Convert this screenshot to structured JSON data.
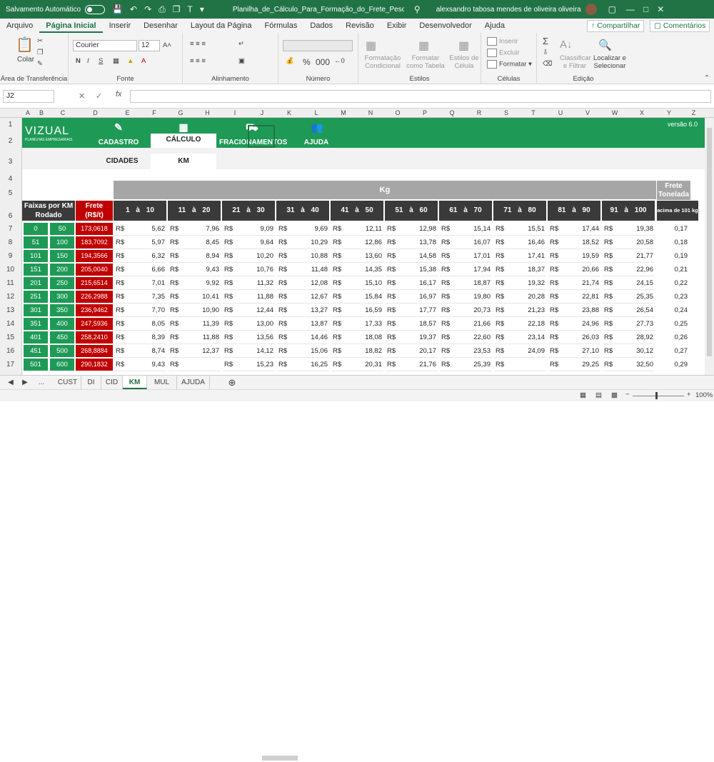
{
  "titlebar": {
    "autosave": "Salvamento Automático",
    "filename": "Planilha_de_Cálculo_Para_Formação_do_Frete_Peso_Fraci...",
    "user": "alexsandro tabosa mendes de oliveira oliveira"
  },
  "menu": [
    "Arquivo",
    "Página Inicial",
    "Inserir",
    "Desenhar",
    "Layout da Página",
    "Fórmulas",
    "Dados",
    "Revisão",
    "Exibir",
    "Desenvolvedor",
    "Ajuda"
  ],
  "share": "Compartilhar",
  "comments": "Comentários",
  "ribbon": {
    "clipboard": {
      "paste": "Colar",
      "label": "Área de Transferência"
    },
    "font": {
      "name": "Courier",
      "size": "12",
      "label": "Fonte",
      "bold": "N",
      "italic": "I",
      "underline": "S"
    },
    "alignment": {
      "label": "Alinhamento"
    },
    "number": {
      "label": "Número"
    },
    "styles": {
      "cond": "Formatação Condicional",
      "table": "Formatar como Tabela",
      "cell": "Estilos de Célula",
      "label": "Estilos"
    },
    "cells": {
      "insert": "Inserir",
      "delete": "Excluir",
      "format": "Formatar",
      "label": "Células"
    },
    "edit": {
      "sort": "Classificar e Filtrar",
      "find": "Localizar e Selecionar",
      "label": "Edição"
    }
  },
  "namebox": "J2",
  "columns": [
    "A",
    "B",
    "C",
    "D",
    "E",
    "F",
    "G",
    "H",
    "I",
    "J",
    "K",
    "L",
    "M",
    "N",
    "O",
    "P",
    "Q",
    "R",
    "S",
    "T",
    "U",
    "V",
    "W",
    "X",
    "Y",
    "Z"
  ],
  "rows": [
    "1",
    "2",
    "3",
    "4",
    "5",
    "6",
    "7",
    "8",
    "9",
    "10",
    "11",
    "12",
    "13",
    "14",
    "15",
    "16",
    "17"
  ],
  "app": {
    "logo": "VIZUAL",
    "logo_sub": "PLANILHAS EMPRESARIAIS",
    "version": "versão 6.0",
    "nav": [
      "CADASTRO",
      "CÁLCULO",
      "FRACIONAMENTOS",
      "AJUDA"
    ],
    "subnav": [
      "CIDADES",
      "KM"
    ]
  },
  "table": {
    "kg_label": "Kg",
    "frete_tonelada": "Frete Tonelada",
    "faixas_header": "Faixas por KM Rodado",
    "frete_header": "Frete (R$/t)",
    "acima_header": "acima de 101 kg",
    "ranges": [
      "1  à  10",
      "11  à  20",
      "21  à  30",
      "31  à  40",
      "41  à  50",
      "51  à  60",
      "61  à  70",
      "71  à  80",
      "81  à  90",
      "91  à  100"
    ],
    "currency": "R$",
    "rows": [
      {
        "from": "0",
        "to": "50",
        "frete": "173,0618",
        "vals": [
          "5,62",
          "7,96",
          "9,09",
          "9,69",
          "12,11",
          "12,98",
          "15,14",
          "15,51",
          "17,44",
          "19,38"
        ],
        "ton": "0,17"
      },
      {
        "from": "51",
        "to": "100",
        "frete": "183,7092",
        "vals": [
          "5,97",
          "8,45",
          "9,64",
          "10,29",
          "12,86",
          "13,78",
          "16,07",
          "16,46",
          "18,52",
          "20,58"
        ],
        "ton": "0,18"
      },
      {
        "from": "101",
        "to": "150",
        "frete": "194,3566",
        "vals": [
          "6,32",
          "8,94",
          "10,20",
          "10,88",
          "13,60",
          "14,58",
          "17,01",
          "17,41",
          "19,59",
          "21,77"
        ],
        "ton": "0,19"
      },
      {
        "from": "151",
        "to": "200",
        "frete": "205,0040",
        "vals": [
          "6,66",
          "9,43",
          "10,76",
          "11,48",
          "14,35",
          "15,38",
          "17,94",
          "18,37",
          "20,66",
          "22,96"
        ],
        "ton": "0,21"
      },
      {
        "from": "201",
        "to": "250",
        "frete": "215,6514",
        "vals": [
          "7,01",
          "9,92",
          "11,32",
          "12,08",
          "15,10",
          "16,17",
          "18,87",
          "19,32",
          "21,74",
          "24,15"
        ],
        "ton": "0,22"
      },
      {
        "from": "251",
        "to": "300",
        "frete": "226,2988",
        "vals": [
          "7,35",
          "10,41",
          "11,88",
          "12,67",
          "15,84",
          "16,97",
          "19,80",
          "20,28",
          "22,81",
          "25,35"
        ],
        "ton": "0,23"
      },
      {
        "from": "301",
        "to": "350",
        "frete": "236,9462",
        "vals": [
          "7,70",
          "10,90",
          "12,44",
          "13,27",
          "16,59",
          "17,77",
          "20,73",
          "21,23",
          "23,88",
          "26,54"
        ],
        "ton": "0,24"
      },
      {
        "from": "351",
        "to": "400",
        "frete": "247,5936",
        "vals": [
          "8,05",
          "11,39",
          "13,00",
          "13,87",
          "17,33",
          "18,57",
          "21,66",
          "22,18",
          "24,96",
          "27,73"
        ],
        "ton": "0,25"
      },
      {
        "from": "401",
        "to": "450",
        "frete": "258,2410",
        "vals": [
          "8,39",
          "11,88",
          "13,56",
          "14,46",
          "18,08",
          "19,37",
          "22,60",
          "23,14",
          "26,03",
          "28,92"
        ],
        "ton": "0,26"
      },
      {
        "from": "451",
        "to": "500",
        "frete": "268,8884",
        "vals": [
          "8,74",
          "12,37",
          "14,12",
          "15,06",
          "18,82",
          "20,17",
          "23,53",
          "24,09",
          "27,10",
          "30,12"
        ],
        "ton": "0,27"
      },
      {
        "from": "501",
        "to": "600",
        "frete": "290,1832",
        "vals": [
          "9,43",
          "",
          "15,23",
          "16,25",
          "20,31",
          "21,76",
          "25,39",
          "",
          "29,25",
          "32,50"
        ],
        "ton": "0,29"
      }
    ]
  },
  "sheettabs": [
    "CUST",
    "DI",
    "CID",
    "KM",
    "MUL",
    "AJUDA"
  ],
  "active_sheet": "KM",
  "zoom": "100%"
}
